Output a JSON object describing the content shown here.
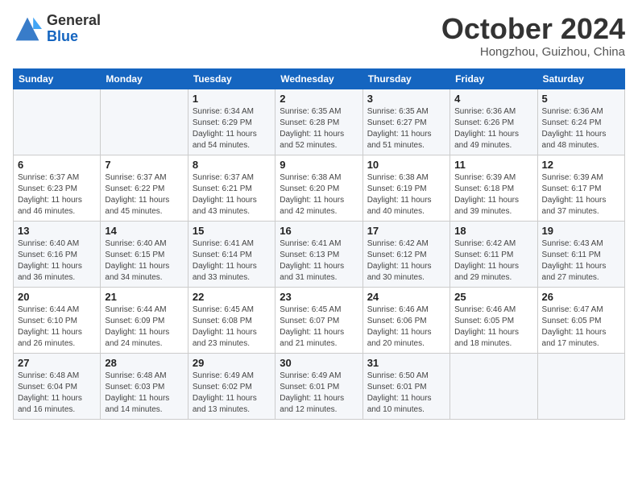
{
  "header": {
    "logo_general": "General",
    "logo_blue": "Blue",
    "month": "October 2024",
    "location": "Hongzhou, Guizhou, China"
  },
  "days_of_week": [
    "Sunday",
    "Monday",
    "Tuesday",
    "Wednesday",
    "Thursday",
    "Friday",
    "Saturday"
  ],
  "weeks": [
    [
      {
        "num": "",
        "content": ""
      },
      {
        "num": "",
        "content": ""
      },
      {
        "num": "1",
        "content": "Sunrise: 6:34 AM\nSunset: 6:29 PM\nDaylight: 11 hours and 54 minutes."
      },
      {
        "num": "2",
        "content": "Sunrise: 6:35 AM\nSunset: 6:28 PM\nDaylight: 11 hours and 52 minutes."
      },
      {
        "num": "3",
        "content": "Sunrise: 6:35 AM\nSunset: 6:27 PM\nDaylight: 11 hours and 51 minutes."
      },
      {
        "num": "4",
        "content": "Sunrise: 6:36 AM\nSunset: 6:26 PM\nDaylight: 11 hours and 49 minutes."
      },
      {
        "num": "5",
        "content": "Sunrise: 6:36 AM\nSunset: 6:24 PM\nDaylight: 11 hours and 48 minutes."
      }
    ],
    [
      {
        "num": "6",
        "content": "Sunrise: 6:37 AM\nSunset: 6:23 PM\nDaylight: 11 hours and 46 minutes."
      },
      {
        "num": "7",
        "content": "Sunrise: 6:37 AM\nSunset: 6:22 PM\nDaylight: 11 hours and 45 minutes."
      },
      {
        "num": "8",
        "content": "Sunrise: 6:37 AM\nSunset: 6:21 PM\nDaylight: 11 hours and 43 minutes."
      },
      {
        "num": "9",
        "content": "Sunrise: 6:38 AM\nSunset: 6:20 PM\nDaylight: 11 hours and 42 minutes."
      },
      {
        "num": "10",
        "content": "Sunrise: 6:38 AM\nSunset: 6:19 PM\nDaylight: 11 hours and 40 minutes."
      },
      {
        "num": "11",
        "content": "Sunrise: 6:39 AM\nSunset: 6:18 PM\nDaylight: 11 hours and 39 minutes."
      },
      {
        "num": "12",
        "content": "Sunrise: 6:39 AM\nSunset: 6:17 PM\nDaylight: 11 hours and 37 minutes."
      }
    ],
    [
      {
        "num": "13",
        "content": "Sunrise: 6:40 AM\nSunset: 6:16 PM\nDaylight: 11 hours and 36 minutes."
      },
      {
        "num": "14",
        "content": "Sunrise: 6:40 AM\nSunset: 6:15 PM\nDaylight: 11 hours and 34 minutes."
      },
      {
        "num": "15",
        "content": "Sunrise: 6:41 AM\nSunset: 6:14 PM\nDaylight: 11 hours and 33 minutes."
      },
      {
        "num": "16",
        "content": "Sunrise: 6:41 AM\nSunset: 6:13 PM\nDaylight: 11 hours and 31 minutes."
      },
      {
        "num": "17",
        "content": "Sunrise: 6:42 AM\nSunset: 6:12 PM\nDaylight: 11 hours and 30 minutes."
      },
      {
        "num": "18",
        "content": "Sunrise: 6:42 AM\nSunset: 6:11 PM\nDaylight: 11 hours and 29 minutes."
      },
      {
        "num": "19",
        "content": "Sunrise: 6:43 AM\nSunset: 6:11 PM\nDaylight: 11 hours and 27 minutes."
      }
    ],
    [
      {
        "num": "20",
        "content": "Sunrise: 6:44 AM\nSunset: 6:10 PM\nDaylight: 11 hours and 26 minutes."
      },
      {
        "num": "21",
        "content": "Sunrise: 6:44 AM\nSunset: 6:09 PM\nDaylight: 11 hours and 24 minutes."
      },
      {
        "num": "22",
        "content": "Sunrise: 6:45 AM\nSunset: 6:08 PM\nDaylight: 11 hours and 23 minutes."
      },
      {
        "num": "23",
        "content": "Sunrise: 6:45 AM\nSunset: 6:07 PM\nDaylight: 11 hours and 21 minutes."
      },
      {
        "num": "24",
        "content": "Sunrise: 6:46 AM\nSunset: 6:06 PM\nDaylight: 11 hours and 20 minutes."
      },
      {
        "num": "25",
        "content": "Sunrise: 6:46 AM\nSunset: 6:05 PM\nDaylight: 11 hours and 18 minutes."
      },
      {
        "num": "26",
        "content": "Sunrise: 6:47 AM\nSunset: 6:05 PM\nDaylight: 11 hours and 17 minutes."
      }
    ],
    [
      {
        "num": "27",
        "content": "Sunrise: 6:48 AM\nSunset: 6:04 PM\nDaylight: 11 hours and 16 minutes."
      },
      {
        "num": "28",
        "content": "Sunrise: 6:48 AM\nSunset: 6:03 PM\nDaylight: 11 hours and 14 minutes."
      },
      {
        "num": "29",
        "content": "Sunrise: 6:49 AM\nSunset: 6:02 PM\nDaylight: 11 hours and 13 minutes."
      },
      {
        "num": "30",
        "content": "Sunrise: 6:49 AM\nSunset: 6:01 PM\nDaylight: 11 hours and 12 minutes."
      },
      {
        "num": "31",
        "content": "Sunrise: 6:50 AM\nSunset: 6:01 PM\nDaylight: 11 hours and 10 minutes."
      },
      {
        "num": "",
        "content": ""
      },
      {
        "num": "",
        "content": ""
      }
    ]
  ]
}
